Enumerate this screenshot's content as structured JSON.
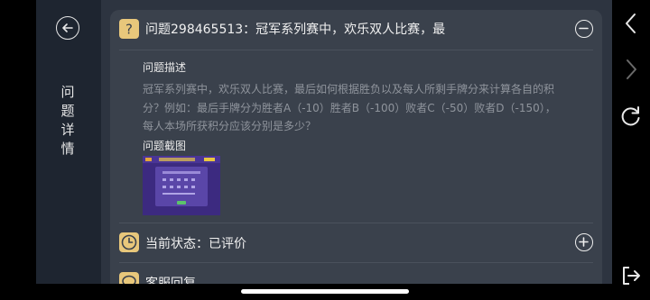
{
  "side": {
    "title": "问题详情"
  },
  "question": {
    "title": "问题298465513：冠军系列赛中，欢乐双人比赛，最",
    "desc_label": "问题描述",
    "desc_text": "冠军系列赛中，欢乐双人比赛，最后如何根据胜负以及每人所剩手牌分来计算各自的积分？例如：最后手牌分为胜者A（-10）胜者B（-100）败者C（-50）败者D（-150），每人本场所获积分应该分别是多少？",
    "screenshot_label": "问题截图"
  },
  "status": {
    "text": "当前状态：已评价"
  },
  "reply": {
    "text": "客服回复"
  },
  "colors": {
    "accent": "#e8c77b",
    "card": "#3a414c",
    "panel": "#2d3440",
    "sidebar": "#1e2530"
  },
  "icons": {
    "back": "back-circle-arrow-icon",
    "question": "question-mark-icon",
    "collapse": "minus-circle-icon",
    "status": "clock-icon",
    "expand": "plus-circle-icon",
    "reply": "chat-icon",
    "nav_back": "chevron-left-icon",
    "nav_forward": "chevron-right-icon",
    "refresh": "refresh-icon",
    "exit": "exit-icon"
  }
}
